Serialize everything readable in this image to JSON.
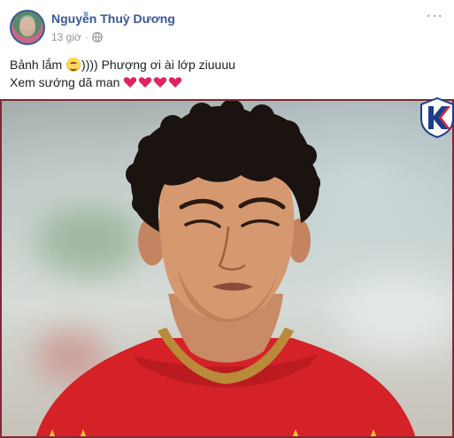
{
  "post": {
    "author": "Nguyễn Thuỳ Dương",
    "timestamp": "13 giờ",
    "privacy_icon": "globe-icon",
    "more_icon": "more-options-icon",
    "text_line1_before": "Bảnh lắm ",
    "text_line1_after": ")))) Phượng ơi ài lớp ziuuuu",
    "text_line2": "Xem sướng dã man ",
    "emoji": "smiling-face-emoji",
    "hearts": 4,
    "heart_color": "#e0245e"
  },
  "photo": {
    "badge_icon": "k-logo-badge",
    "frame_color": "#7e2a35"
  },
  "colors": {
    "author_link": "#385898",
    "meta_text": "#90949c",
    "body_text": "#1c1e21",
    "jersey_red": "#d52128",
    "collar_gold": "#b88a3a"
  }
}
